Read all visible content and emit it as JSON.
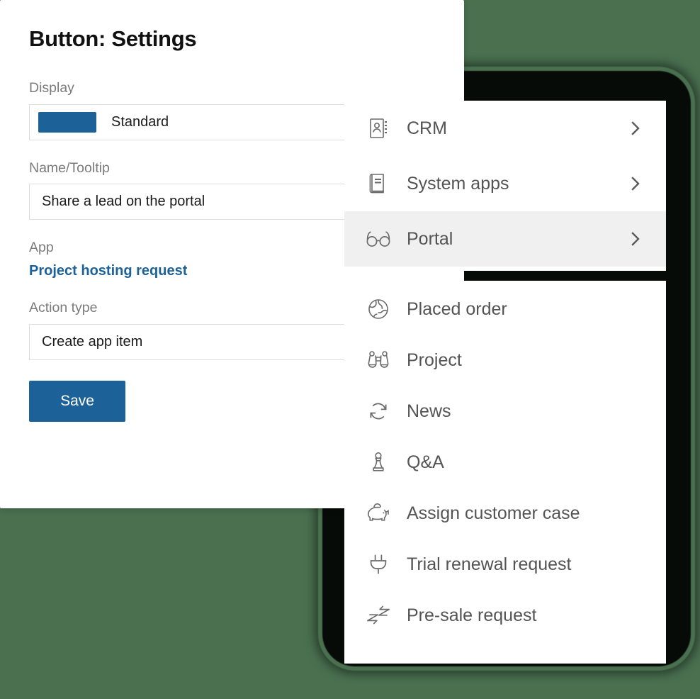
{
  "theme": {
    "background": "#4a7050",
    "accent": "#1c6298",
    "panel_bg": "#ffffff",
    "label_gray": "#7b7b7b",
    "menu_text": "#545454",
    "menu_highlight": "#f0f0f0"
  },
  "settings_panel": {
    "title": "Button: Settings",
    "fields": {
      "display": {
        "label": "Display",
        "value": "Standard",
        "swatch_color": "#1c6298"
      },
      "name_tooltip": {
        "label": "Name/Tooltip",
        "value": "Share a lead on the portal",
        "placeholder": "Name/Tooltip"
      },
      "app": {
        "label": "App",
        "value": "Project hosting request"
      },
      "action_type": {
        "label": "Action type",
        "value": "Create app item"
      }
    },
    "save_label": "Save"
  },
  "menu_primary": {
    "items": [
      {
        "label": "CRM",
        "icon": "address-book-icon",
        "chevron": "chevron-right-icon",
        "active": false
      },
      {
        "label": "System apps",
        "icon": "book-icon",
        "chevron": "chevron-right-icon",
        "active": false
      },
      {
        "label": "Portal",
        "icon": "glasses-icon",
        "chevron": "chevron-right-icon",
        "active": true
      }
    ]
  },
  "menu_secondary": {
    "items": [
      {
        "label": "Placed order",
        "icon": "globe-icon"
      },
      {
        "label": "Project",
        "icon": "binoculars-icon"
      },
      {
        "label": "News",
        "icon": "refresh-icon"
      },
      {
        "label": "Q&A",
        "icon": "chess-pawn-icon"
      },
      {
        "label": "Assign customer case",
        "icon": "piggy-bank-icon"
      },
      {
        "label": "Trial renewal request",
        "icon": "power-plug-icon"
      },
      {
        "label": "Pre-sale request",
        "icon": "lightning-arrows-icon"
      }
    ]
  }
}
